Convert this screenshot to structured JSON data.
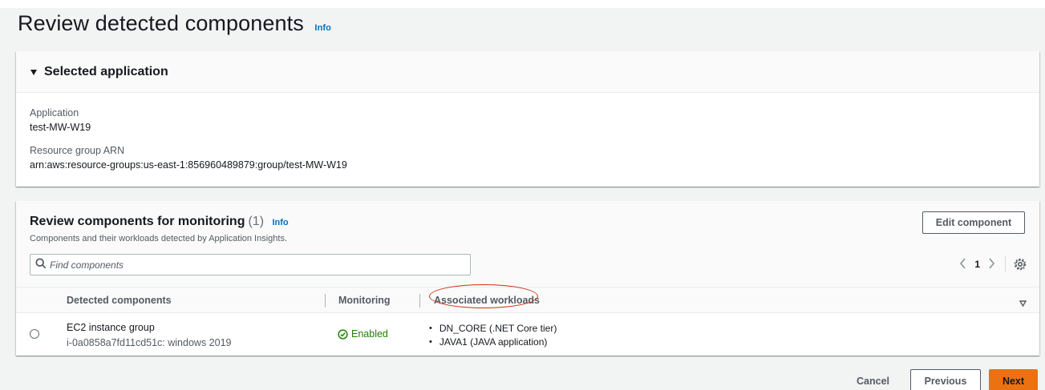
{
  "header": {
    "title": "Review detected components",
    "info_label": "Info"
  },
  "selected_application": {
    "title": "Selected application",
    "application_label": "Application",
    "application_value": "test-MW-W19",
    "arn_label": "Resource group ARN",
    "arn_value": "arn:aws:resource-groups:us-east-1:856960489879:group/test-MW-W19"
  },
  "components": {
    "title": "Review components for monitoring",
    "count": "(1)",
    "info_label": "Info",
    "subtitle": "Components and their workloads detected by Application Insights.",
    "edit_button": "Edit component",
    "search_placeholder": "Find components",
    "pagination": {
      "current_page": "1",
      "prev_icon": "chevron-left-icon",
      "next_icon": "chevron-right-icon"
    },
    "columns": [
      "Detected components",
      "Monitoring",
      "Associated workloads"
    ],
    "rows": [
      {
        "name": "EC2 instance group",
        "detail": "i-0a0858a7fd11cd51c: windows 2019",
        "status": "Enabled",
        "workloads": [
          "DN_CORE (.NET Core tier)",
          "JAVA1 (JAVA application)"
        ]
      }
    ]
  },
  "footer": {
    "cancel": "Cancel",
    "previous": "Previous",
    "next": "Next"
  },
  "colors": {
    "accent_orange": "#ec7211",
    "link_blue": "#0073bb",
    "success_green": "#1d8102",
    "annotation_red": "#d13212"
  }
}
